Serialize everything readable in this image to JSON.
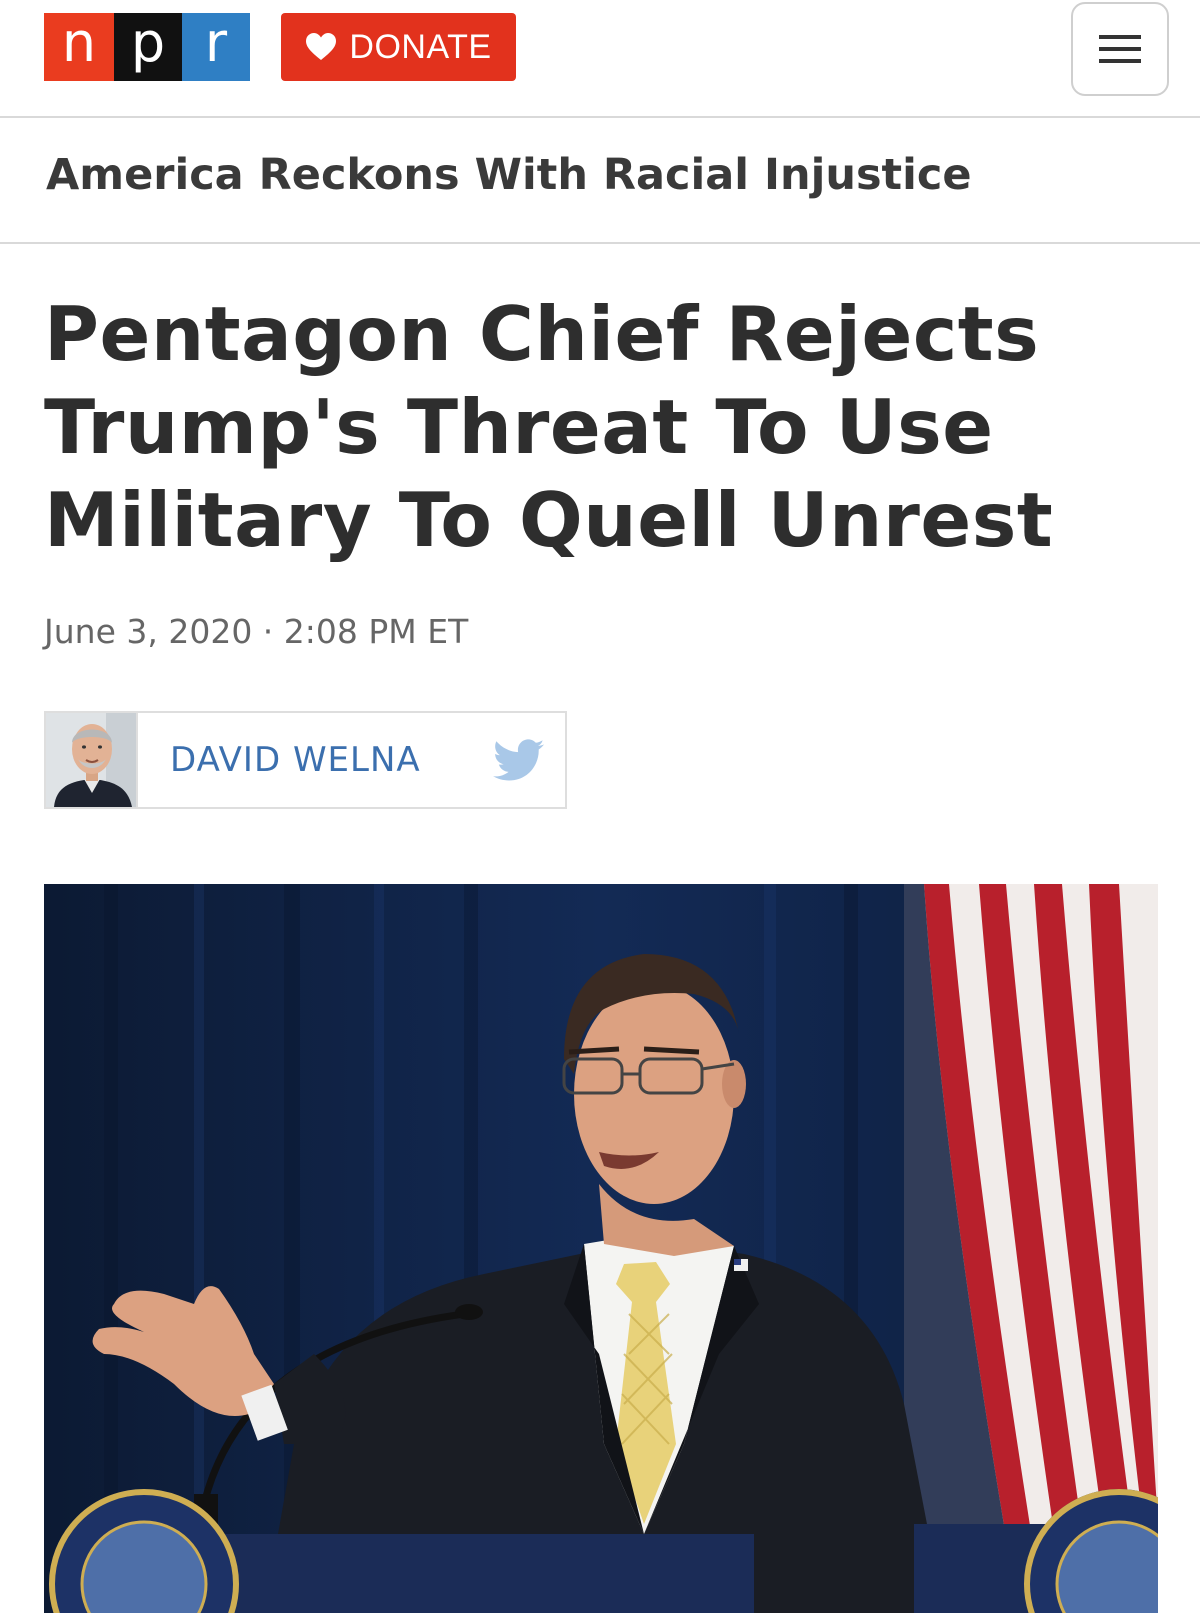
{
  "header": {
    "logo": {
      "letters": [
        "n",
        "p",
        "r"
      ]
    },
    "donate_label": "DONATE",
    "menu_icon": "hamburger-menu-icon"
  },
  "section": {
    "label": "America Reckons With Racial Injustice"
  },
  "article": {
    "headline_lines": [
      "Pentagon Chief Rejects",
      "Trump's Threat To Use",
      "Military To Quell Unrest"
    ],
    "dateline": "June 3, 2020 · 2:08 PM ET",
    "byline": {
      "author": "DAVID WELNA",
      "social_icon": "twitter-icon"
    },
    "photo": {
      "description_icon": "lead-photo"
    }
  },
  "colors": {
    "npr_red": "#ea3c1f",
    "npr_black": "#111111",
    "npr_blue": "#2f7fc4",
    "donate_red": "#e2321d",
    "author_blue": "#3b6fae",
    "twitter_blue": "#a9c8e8"
  }
}
